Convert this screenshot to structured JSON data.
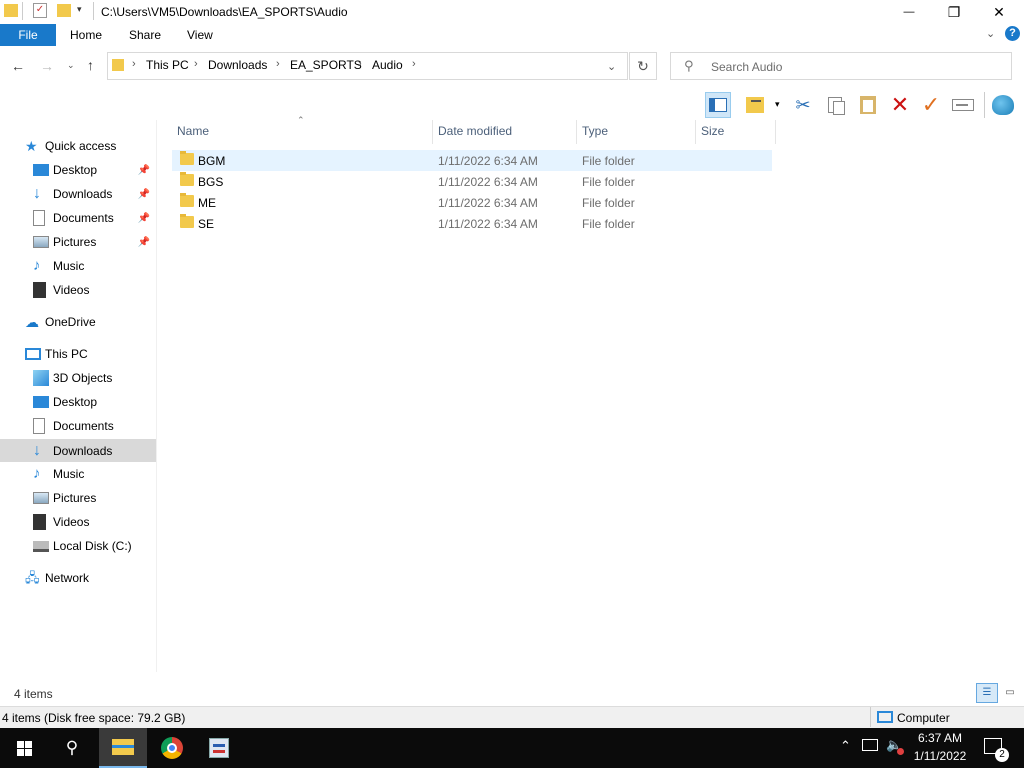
{
  "window": {
    "title_path": "C:\\Users\\VM5\\Downloads\\EA_SPORTS\\Audio",
    "minimize": "—",
    "maximize": "❐",
    "close": "✕"
  },
  "ribbon": {
    "tabs": [
      "File",
      "Home",
      "Share",
      "View"
    ]
  },
  "address": {
    "crumbs": [
      "This PC",
      "Downloads",
      "EA_SPORTS",
      "Audio"
    ],
    "search_placeholder": "Search Audio"
  },
  "nav": {
    "quick_access": "Quick access",
    "quick_items": [
      "Desktop",
      "Downloads",
      "Documents",
      "Pictures",
      "Music",
      "Videos"
    ],
    "onedrive": "OneDrive",
    "this_pc": "This PC",
    "pc_items": [
      "3D Objects",
      "Desktop",
      "Documents",
      "Downloads",
      "Music",
      "Pictures",
      "Videos",
      "Local Disk (C:)"
    ],
    "network": "Network",
    "selected": "Downloads"
  },
  "columns": {
    "name": "Name",
    "date": "Date modified",
    "type": "Type",
    "size": "Size"
  },
  "files": [
    {
      "name": "BGM",
      "date": "1/11/2022 6:34 AM",
      "type": "File folder",
      "size": ""
    },
    {
      "name": "BGS",
      "date": "1/11/2022 6:34 AM",
      "type": "File folder",
      "size": ""
    },
    {
      "name": "ME",
      "date": "1/11/2022 6:34 AM",
      "type": "File folder",
      "size": ""
    },
    {
      "name": "SE",
      "date": "1/11/2022 6:34 AM",
      "type": "File folder",
      "size": ""
    }
  ],
  "status": {
    "item_count": "4 items",
    "disk_info": "4 items (Disk free space: 79.2 GB)",
    "computer": "Computer"
  },
  "taskbar": {
    "time": "6:37 AM",
    "date": "1/11/2022",
    "notification_count": "2"
  },
  "colors": {
    "file_tab": "#1979ca",
    "folder": "#f2c94c",
    "selection": "#e5f3ff",
    "taskbar": "#0b0b0b"
  }
}
